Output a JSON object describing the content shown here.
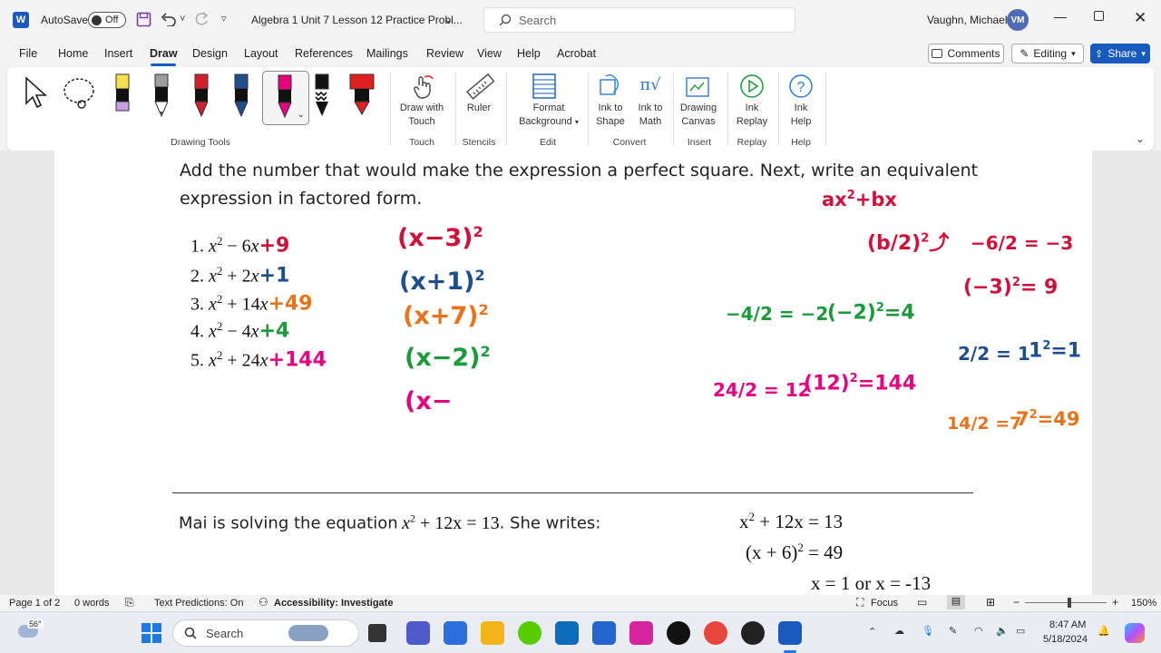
{
  "titlebar": {
    "autosave_label": "AutoSave",
    "autosave_state": "Off",
    "doc_title": "Algebra 1 Unit 7 Lesson 12 Practice Probl...",
    "search_placeholder": "Search",
    "user_name": "Vaughn, Michael",
    "user_initials": "VM"
  },
  "menu": {
    "items": [
      "File",
      "Home",
      "Insert",
      "Draw",
      "Design",
      "Layout",
      "References",
      "Mailings",
      "Review",
      "View",
      "Help",
      "Acrobat"
    ],
    "active": "Draw",
    "comments_label": "Comments",
    "editing_label": "Editing",
    "share_label": "Share"
  },
  "ribbon": {
    "groups": {
      "drawing_tools": "Drawing Tools",
      "touch": "Touch",
      "stencils": "Stencils",
      "edit": "Edit",
      "convert": "Convert",
      "insert": "Insert",
      "replay": "Replay",
      "help": "Help"
    },
    "buttons": {
      "draw_with_touch_1": "Draw with",
      "draw_with_touch_2": "Touch",
      "ruler": "Ruler",
      "format_background_1": "Format",
      "format_background_2": "Background",
      "ink_to_shape_1": "Ink to",
      "ink_to_shape_2": "Shape",
      "ink_to_math_1": "Ink to",
      "ink_to_math_2": "Math",
      "drawing_canvas_1": "Drawing",
      "drawing_canvas_2": "Canvas",
      "ink_replay_1": "Ink",
      "ink_replay_2": "Replay",
      "ink_help_1": "Ink",
      "ink_help_2": "Help"
    },
    "pen_colors": {
      "highlighter_yellow": "#f4e04d",
      "pencil_gray": "#9e9e9e",
      "pen_red": "#d01f2f",
      "pen_blue": "#1f4e8c",
      "pen_magenta": "#e6007e",
      "pen_black": "#111111",
      "pen_red2": "#e02020"
    }
  },
  "document": {
    "instruction_line1": "Add the number that would make the expression a perfect square. Next, write an equivalent",
    "instruction_line2": "expression in factored form.",
    "problems": [
      {
        "num": "1.",
        "a": "− 6",
        "add": "+9",
        "color": "#d0103a"
      },
      {
        "num": "2.",
        "a": "+ 2",
        "add": "+1",
        "color": "#1f4e8c"
      },
      {
        "num": "3.",
        "a": "+ 14",
        "add": "+49",
        "color": "#e8731a"
      },
      {
        "num": "4.",
        "a": "− 4",
        "add": "+4",
        "color": "#1a9a3a"
      },
      {
        "num": "5.",
        "a": "+ 24",
        "add": "+144",
        "color": "#e6007e"
      }
    ],
    "factored": [
      {
        "text": "(x−3)",
        "exp": "2",
        "color": "#d0103a"
      },
      {
        "text": "(x+1)",
        "exp": "2",
        "color": "#1f4e8c"
      },
      {
        "text": "(x+7)",
        "exp": "2",
        "color": "#e8731a"
      },
      {
        "text": "(x−2)",
        "exp": "2",
        "color": "#1a9a3a"
      },
      {
        "text": "(x−",
        "exp": "",
        "color": "#e6007e"
      }
    ],
    "notes": {
      "red_formula": "ax",
      "red_formula_exp": "2",
      "red_formula_tail": "+bx",
      "red_half": "(b/2)",
      "red_half_exp": "2",
      "red_calc1": "−6/2 = −3",
      "red_calc2": "(−3)",
      "red_calc2_tail": "= 9",
      "green_calc": "−4/2 = −2",
      "green_sq": "(−2)",
      "green_sq_tail": "=4",
      "blue_calc": "2/2 = 1",
      "blue_sq": "1",
      "blue_sq_tail": "=1",
      "pink_calc": "24/2 = 12",
      "pink_sq": "(12)",
      "pink_sq_tail": "=144",
      "orange_calc": "14/2 =7",
      "orange_sq": "7",
      "orange_sq_tail": "=49",
      "exp2": "2"
    },
    "mai_text": "Mai is solving the equation",
    "mai_eq": "+ 12x = 13",
    "mai_tail": ". She writes:",
    "steps": [
      {
        "pre": "x",
        "exp": "2",
        "post": " + 12x = 13"
      },
      {
        "pre": "(x + 6)",
        "exp": "2",
        "post": " = 49"
      },
      {
        "pre": "x = 1 or x = -13",
        "exp": "",
        "post": ""
      }
    ]
  },
  "status": {
    "page": "Page 1 of 2",
    "words": "0 words",
    "text_predictions": "Text Predictions: On",
    "accessibility": "Accessibility: Investigate",
    "focus": "Focus",
    "zoom": "150%"
  },
  "taskbar": {
    "weather": "56°",
    "search_label": "Search",
    "time": "8:47 AM",
    "date": "5/18/2024"
  }
}
